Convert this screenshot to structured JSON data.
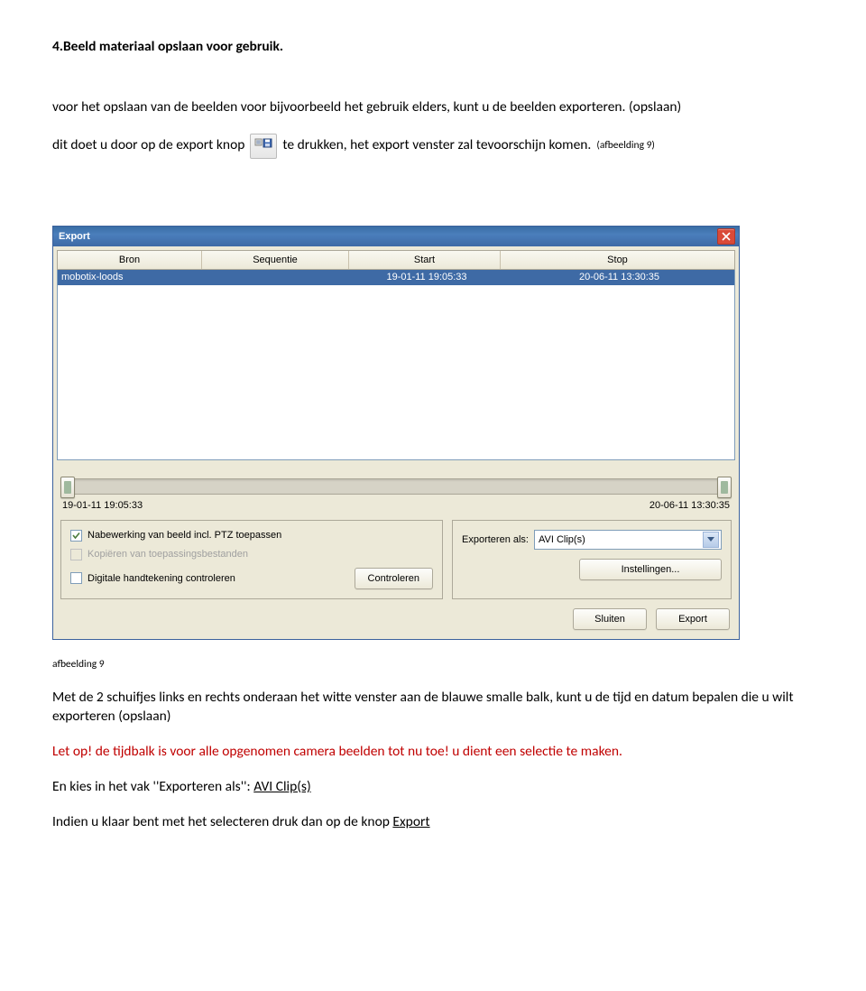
{
  "heading": "4.Beeld materiaal opslaan voor gebruik.",
  "para1": "voor het opslaan van de beelden voor bijvoorbeeld het gebruik elders, kunt u de beelden exporteren. (opslaan)",
  "para2_a": "dit doet u door op de export knop",
  "para2_b": "te drukken, het export venster zal tevoorschijn komen.",
  "para2_note": "(afbeelding 9)",
  "window": {
    "title": "Export",
    "columns": {
      "bron": "Bron",
      "sequentie": "Sequentie",
      "start": "Start",
      "stop": "Stop"
    },
    "row": {
      "bron": "mobotix-loods",
      "sequentie": "",
      "start": "19-01-11 19:05:33",
      "stop": "20-06-11 13:30:35"
    },
    "slider": {
      "from": "19-01-11 19:05:33",
      "to": "20-06-11 13:30:35"
    },
    "options": {
      "cb1": "Nabewerking van beeld incl. PTZ toepassen",
      "cb2": "Kopiëren van toepassingsbestanden",
      "cb3": "Digitale handtekening controleren",
      "controleren": "Controleren",
      "exportAlsLabel": "Exporteren als:",
      "exportAlsValue": "AVI Clip(s)",
      "instellingen": "Instellingen..."
    },
    "footer": {
      "sluiten": "Sluiten",
      "export": "Export"
    }
  },
  "caption": "afbeelding 9",
  "para3": "Met de 2 schuifjes links en rechts onderaan het witte venster aan de blauwe smalle balk, kunt u de tijd en datum bepalen die u wilt exporteren (opslaan)",
  "warn_a": "Let op! de tijdbalk is voor alle opgenomen camera beelden tot nu toe! u dient een selectie te maken.",
  "para4_a": "En kies in het vak ''Exporteren als'': ",
  "para4_u": "AVI Clip(s)",
  "para5_a": "Indien u klaar bent met het selecteren druk dan op de knop ",
  "para5_u": "Export"
}
